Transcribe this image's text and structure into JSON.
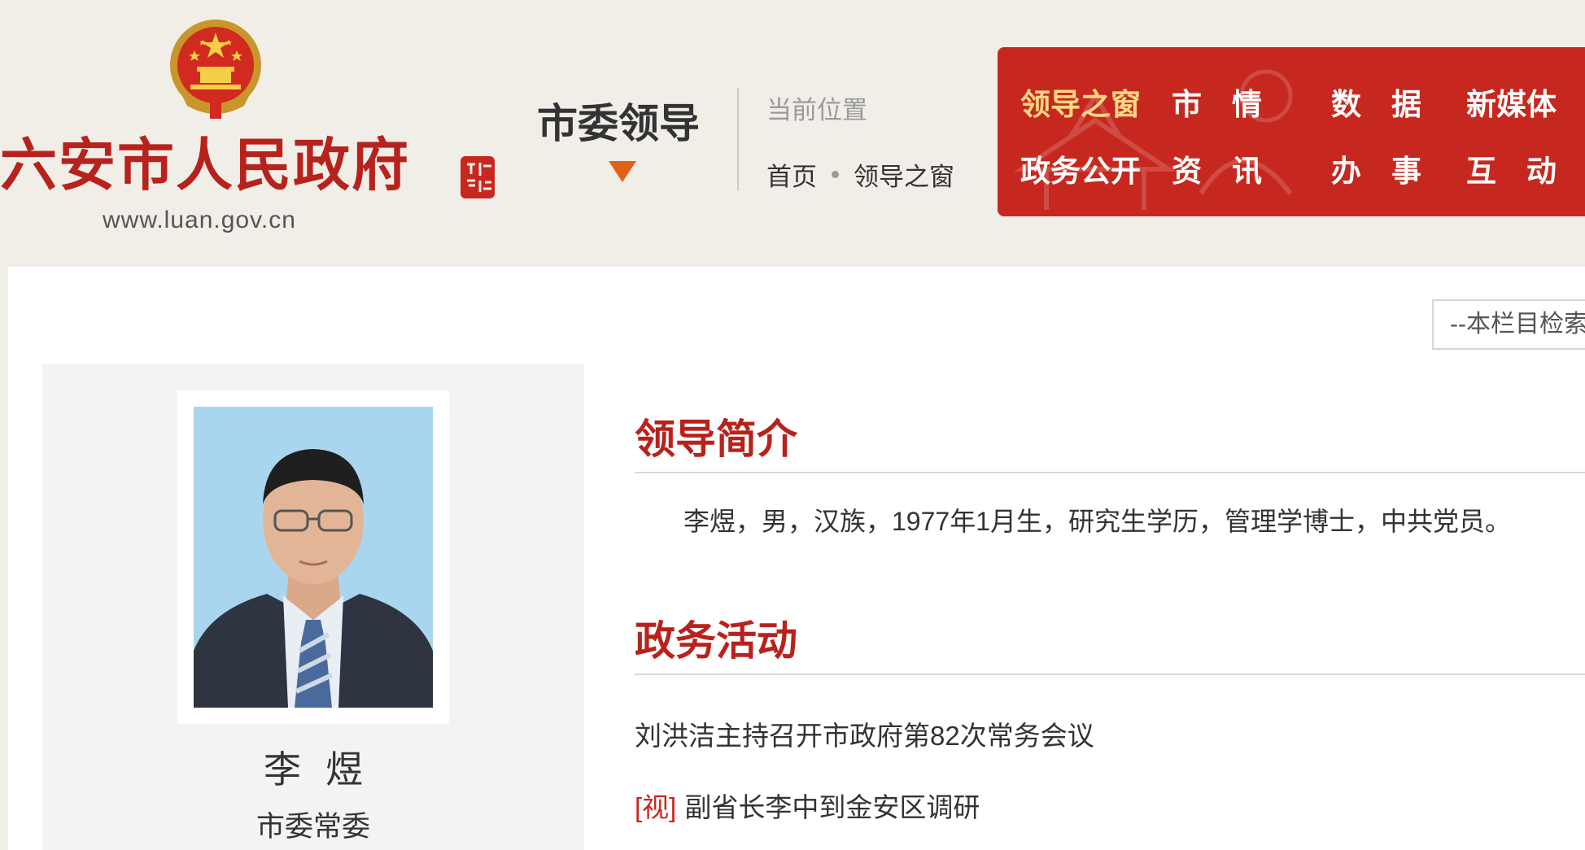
{
  "site": {
    "name": "六安市人民政府",
    "url": "www.luan.gov.cn"
  },
  "channel": {
    "title": "市委领导"
  },
  "location": {
    "label": "当前位置",
    "breadcrumb": [
      "首页",
      "领导之窗"
    ]
  },
  "nav": {
    "items": [
      {
        "label": "领导之窗",
        "active": true
      },
      {
        "label": "市　情"
      },
      {
        "label": "数　据"
      },
      {
        "label": "新媒体"
      },
      {
        "label": "政务公开"
      },
      {
        "label": "资　讯"
      },
      {
        "label": "办　事"
      },
      {
        "label": "互　动"
      }
    ]
  },
  "search": {
    "placeholder": "--本栏目检索"
  },
  "leader": {
    "name": "李煜",
    "title": "市委常委",
    "intro": "李煜，男，汉族，1977年1月生，研究生学历，管理学博士，中共党员。"
  },
  "sections": {
    "intro_title": "领导简介",
    "activity_title": "政务活动"
  },
  "activities": [
    {
      "tag": "",
      "title": "刘洪洁主持召开市政府第82次常务会议"
    },
    {
      "tag": "[视]",
      "title": "副省长李中到金安区调研"
    }
  ],
  "colors": {
    "brand_red": "#c6281f",
    "nav_active": "#ffd785",
    "title_red": "#b8221c"
  }
}
